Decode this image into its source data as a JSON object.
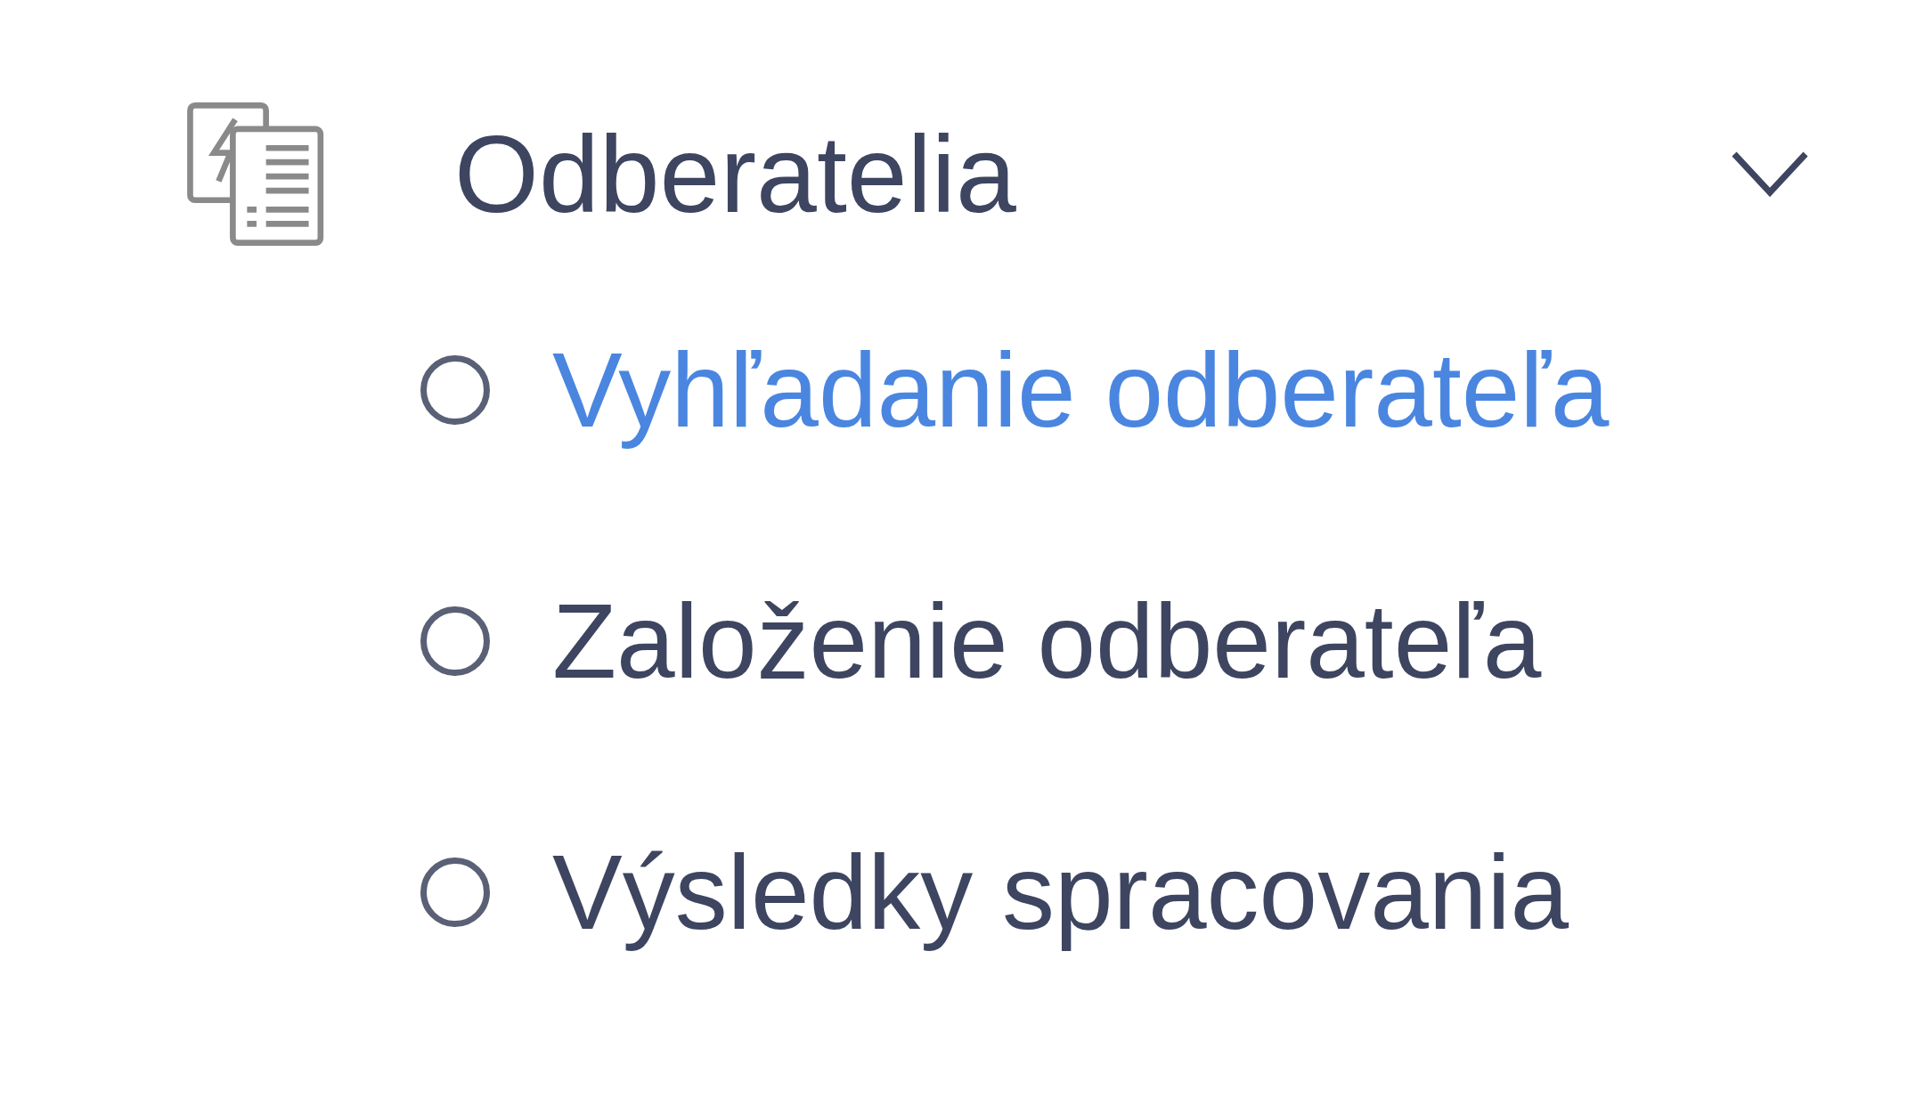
{
  "menu": {
    "title": "Odberatelia",
    "expanded": true,
    "items": [
      {
        "label": "Vyhľadanie odberateľa",
        "selected": true
      },
      {
        "label": "Založenie odberateľa",
        "selected": false
      },
      {
        "label": "Výsledky spracovania",
        "selected": false
      }
    ]
  }
}
